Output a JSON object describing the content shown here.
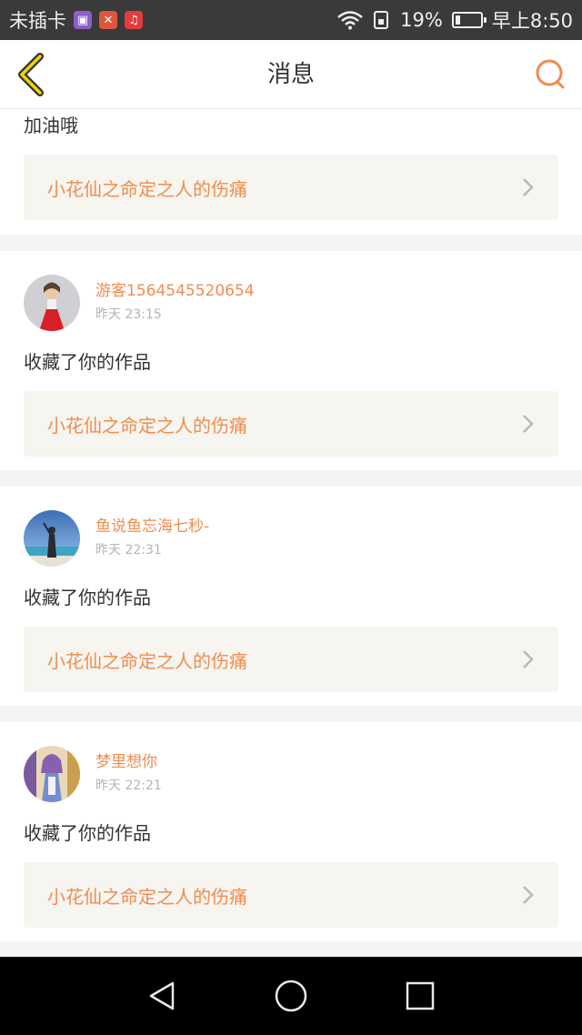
{
  "status_bar": {
    "carrier": "未插卡",
    "battery_text": "19%",
    "battery_level": 0.19,
    "time": "早上8:50",
    "app_icons": [
      {
        "name": "gallery-icon",
        "color": "#8e5ec8"
      },
      {
        "name": "tool-icon",
        "color": "#e0563c"
      },
      {
        "name": "music-icon",
        "color": "#e23c3c"
      }
    ]
  },
  "header": {
    "title": "消息",
    "accent": "#f08c50",
    "back_icon": "chevron-left-icon",
    "search_icon": "search-icon"
  },
  "first_card": {
    "message": "加油哦",
    "work_title": "小花仙之命定之人的伤痛"
  },
  "messages": [
    {
      "username": "游客1564545520654",
      "time": "昨天 23:15",
      "message": "收藏了你的作品",
      "work_title": "小花仙之命定之人的伤痛",
      "avatar": "girl-red-dress-avatar"
    },
    {
      "username": "鱼说鱼忘海七秒-",
      "time": "昨天 22:31",
      "message": "收藏了你的作品",
      "work_title": "小花仙之命定之人的伤痛",
      "avatar": "beach-sky-avatar"
    },
    {
      "username": "梦里想你",
      "time": "昨天 22:21",
      "message": "收藏了你的作品",
      "work_title": "小花仙之命定之人的伤痛",
      "avatar": "anime-character-avatar"
    }
  ],
  "nav_bar": {
    "back": "triangle-back-icon",
    "home": "circle-home-icon",
    "recents": "square-recents-icon"
  }
}
